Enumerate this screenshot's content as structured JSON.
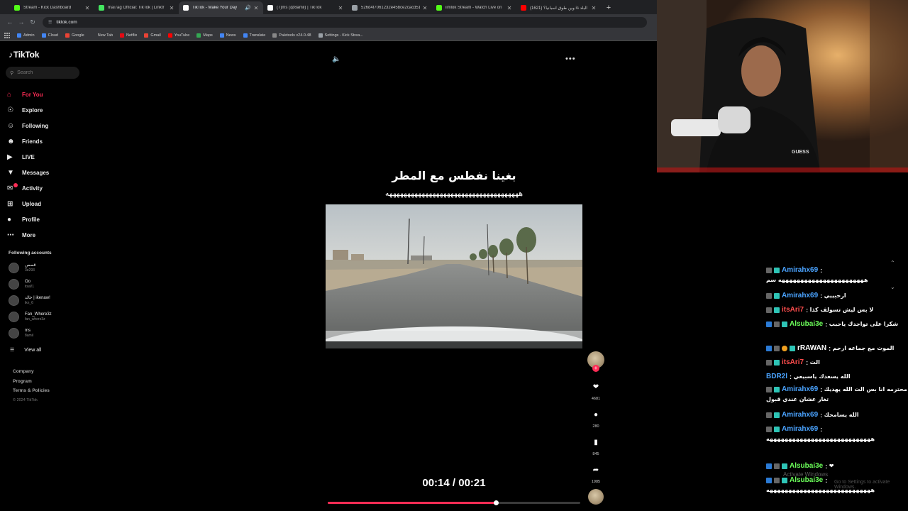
{
  "browser": {
    "tabs": [
      {
        "title": "Stream - Kick Dashboard",
        "color": "#53fc18",
        "active": false
      },
      {
        "title": "mai7ag Official: TikTok | Linktr",
        "color": "#43e660",
        "active": false
      },
      {
        "title": "TikTok - Make Your Day",
        "color": "#ffffff",
        "active": true
      },
      {
        "title": "(7)ms (@8amil) | TikTok",
        "color": "#ffffff",
        "active": false
      },
      {
        "title": "526d4f7061232e45bce2cacd51b",
        "color": "#9aa0a6",
        "active": false
      },
      {
        "title": "iimlok Stream - Watch Live on",
        "color": "#53fc18",
        "active": false
      },
      {
        "title": "(1621) وين طوق اسبانيا؟ is البلد",
        "color": "#ff0000",
        "active": false
      }
    ],
    "url": "tiktok.com",
    "bookmarks": [
      {
        "label": "Admin",
        "color": "#4285f4"
      },
      {
        "label": "Cloud",
        "color": "#4285f4"
      },
      {
        "label": "Google",
        "color": "#ea4335"
      },
      {
        "label": "New Tab",
        "color": "#35363a"
      },
      {
        "label": "Netflix",
        "color": "#e50914"
      },
      {
        "label": "Gmail",
        "color": "#ea4335"
      },
      {
        "label": "YouTube",
        "color": "#ff0000"
      },
      {
        "label": "Maps",
        "color": "#34a853"
      },
      {
        "label": "News",
        "color": "#4285f4"
      },
      {
        "label": "Translate",
        "color": "#4285f4"
      },
      {
        "label": "Paletools v24.0.48",
        "color": "#888888"
      },
      {
        "label": "Settings - Kick Strea...",
        "color": "#9aa0a6"
      }
    ]
  },
  "sidebar": {
    "logo": "TikTok",
    "search_placeholder": "Search",
    "nav": [
      {
        "label": "For You",
        "icon": "home-icon",
        "active": true
      },
      {
        "label": "Explore",
        "icon": "compass-icon",
        "active": false
      },
      {
        "label": "Following",
        "icon": "following-icon",
        "active": false
      },
      {
        "label": "Friends",
        "icon": "friends-icon",
        "active": false
      },
      {
        "label": "LIVE",
        "icon": "live-icon",
        "active": false
      },
      {
        "label": "Messages",
        "icon": "messages-icon",
        "active": false
      },
      {
        "label": "Activity",
        "icon": "activity-icon",
        "active": false
      },
      {
        "label": "Upload",
        "icon": "upload-icon",
        "active": false
      },
      {
        "label": "Profile",
        "icon": "profile-icon",
        "active": false
      },
      {
        "label": "More",
        "icon": "more-icon",
        "active": false
      }
    ],
    "following_title": "Following accounts",
    "following": [
      {
        "name": "قصص",
        "handle": "3e293"
      },
      {
        "name": "Oo",
        "handle": "itsal!1"
      },
      {
        "name": "خالد | ikenaw!",
        "handle": "ikn_6"
      },
      {
        "name": "Fan_Where3z",
        "handle": "fan_where3z"
      },
      {
        "name": "ms",
        "handle": "8amil"
      }
    ],
    "view_all": "View all",
    "footer": {
      "company": "Company",
      "program": "Program",
      "terms": "Terms & Policies",
      "copyright": "© 2024 TikTok"
    }
  },
  "video": {
    "caption_line1": "بغينا نفطس مع المطر",
    "caption_line2": "هههههههههههههههههههههههههههههههههههههه",
    "time": "00:14 / 00:21",
    "progress_fraction": 0.667,
    "likes": "4681",
    "comments": "280",
    "saves": "845",
    "shares": "1985"
  },
  "chat": {
    "messages": [
      {
        "user": "Amirahx69",
        "text": "",
        "user_color": "#4aa3ff",
        "badges": [
          "b-gray",
          "b-teal"
        ],
        "extra": "هههههههههههههههههههههههه سم"
      },
      {
        "user": "Amirahx69",
        "text": "ارحبييي",
        "user_color": "#4aa3ff",
        "badges": [
          "b-gray",
          "b-teal"
        ],
        "extra": ""
      },
      {
        "user": "itsAri7",
        "text": "لا بس ليش تسولف كذا",
        "user_color": "#ff4d4d",
        "badges": [
          "b-gray",
          "b-teal"
        ],
        "extra": ""
      },
      {
        "user": "Alsubai3e",
        "text": "شكرا على تواجدك ياحبب",
        "user_color": "#6cff5a",
        "badges": [
          "b-blue",
          "b-gray",
          "b-teal"
        ],
        "extra": ""
      },
      {
        "user": "rRAWAN",
        "text": "الموت مع جماعه ارحم",
        "user_color": "#ffffff",
        "badges": [
          "b-blue",
          "b-gray",
          "b-orange",
          "b-teal"
        ],
        "extra": ""
      },
      {
        "user": "itsAri7",
        "text": "الت",
        "user_color": "#ff4d4d",
        "badges": [
          "b-gray",
          "b-teal"
        ],
        "extra": ""
      },
      {
        "user": "BDR2l",
        "text": "الله يسعدك ياسبيعي",
        "user_color": "#4aa3ff",
        "badges": [],
        "extra": ""
      },
      {
        "user": "Amirahx69",
        "text": "محترمه انا بس الت الله يهديك",
        "user_color": "#4aa3ff",
        "badges": [
          "b-gray",
          "b-teal"
        ],
        "extra": "تغار عشان عندي قبول"
      },
      {
        "user": "Amirahx69",
        "text": "الله يسامحك",
        "user_color": "#4aa3ff",
        "badges": [
          "b-gray",
          "b-teal"
        ],
        "extra": ""
      },
      {
        "user": "Amirahx69",
        "text": "",
        "user_color": "#4aa3ff",
        "badges": [
          "b-gray",
          "b-teal"
        ],
        "extra": "ههههههههههههههههههههههههههههه"
      },
      {
        "user": "Alsubai3e",
        "text": "❤",
        "user_color": "#6cff5a",
        "badges": [
          "b-blue",
          "b-gray",
          "b-teal"
        ],
        "extra": ""
      },
      {
        "user": "Alsubai3e",
        "text": "",
        "user_color": "#6cff5a",
        "badges": [
          "b-blue",
          "b-gray",
          "b-teal"
        ],
        "extra": "ههههههههههههههههههههههههههههه"
      }
    ],
    "watermark": "Activate Windows",
    "watermark2": "Go to Settings to activate Windows."
  }
}
